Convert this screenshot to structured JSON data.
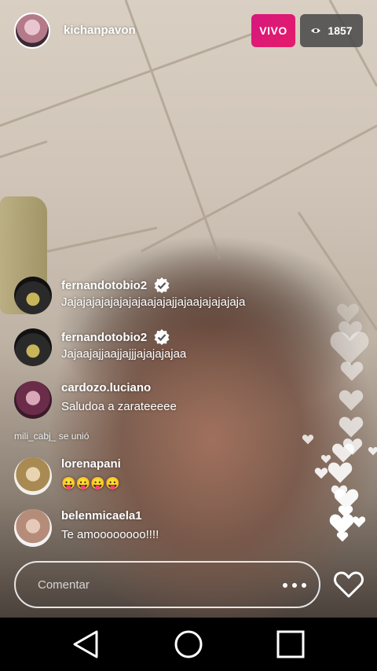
{
  "header": {
    "username": "kichanpavon",
    "live_label": "VIVO",
    "viewer_count": "1857",
    "viewer_icon": "eye-icon"
  },
  "comments": [
    {
      "username": "fernandotobio2",
      "verified": true,
      "text": "Jajajajajajajajajaajajajjajaajajajajaja"
    },
    {
      "username": "fernandotobio2",
      "verified": true,
      "text": "Jajaajajjaajjajjjajajajajaa"
    },
    {
      "username": "cardozo.luciano",
      "verified": false,
      "text": "Saludoa a zarateeeee"
    },
    {
      "username": "lorenapani",
      "verified": false,
      "text": "😛😛😛😛"
    },
    {
      "username": "belenmicaela1",
      "verified": false,
      "text": "Te amoooooooo!!!!"
    }
  ],
  "join_notice": "mili_cabj_ se unió",
  "comment_input": {
    "placeholder": "Comentar",
    "more_icon": "more-dots-icon",
    "like_icon": "heart-icon"
  },
  "navbar": {
    "back_icon": "back-triangle-icon",
    "home_icon": "home-circle-icon",
    "recent_icon": "recent-square-icon"
  },
  "colors": {
    "live": "#e51c6b",
    "viewer_badge": "#464646",
    "verified": "#ffffff"
  }
}
